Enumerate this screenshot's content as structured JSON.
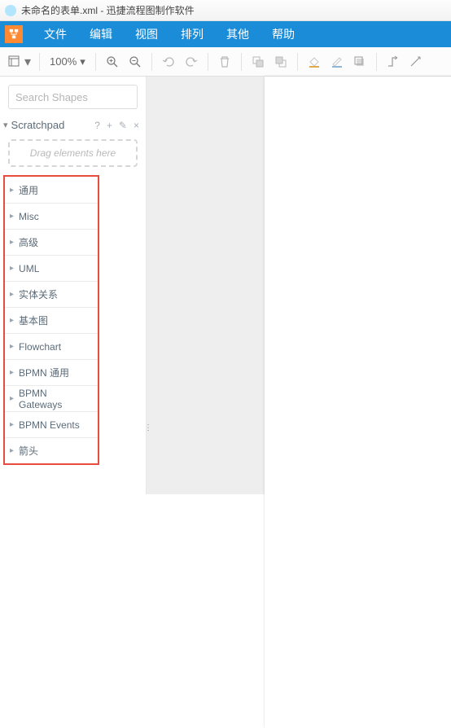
{
  "window": {
    "title": "未命名的表单.xml - 迅捷流程图制作软件"
  },
  "menu": {
    "items": [
      "文件",
      "编辑",
      "视图",
      "排列",
      "其他",
      "帮助"
    ]
  },
  "toolbar": {
    "zoom": "100%"
  },
  "sidebar": {
    "search_placeholder": "Search Shapes",
    "scratchpad_label": "Scratchpad",
    "dropzone_text": "Drag elements here",
    "categories": [
      "通用",
      "Misc",
      "高级",
      "UML",
      "实体关系",
      "基本图",
      "Flowchart",
      "BPMN 通用",
      "BPMN Gateways",
      "BPMN Events",
      "箭头"
    ]
  }
}
